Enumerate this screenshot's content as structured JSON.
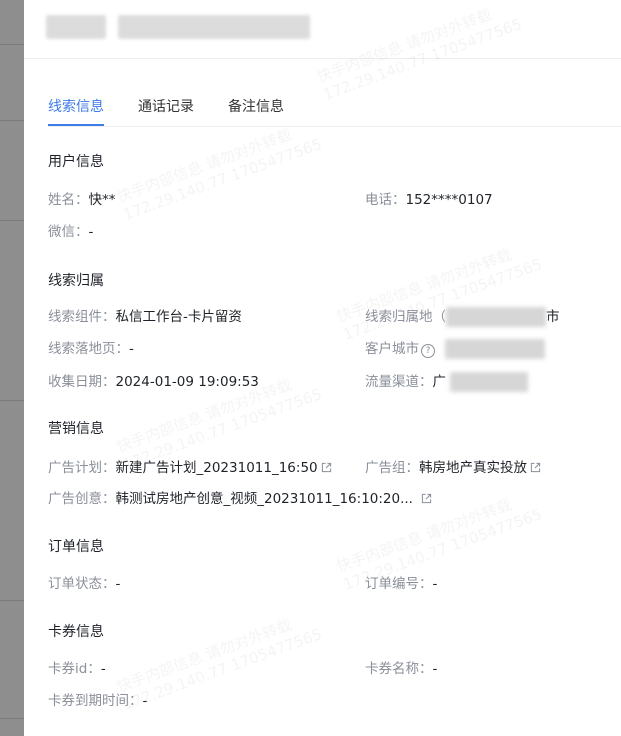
{
  "tabs": [
    {
      "label": "线索信息"
    },
    {
      "label": "通话记录"
    },
    {
      "label": "备注信息"
    }
  ],
  "sections": {
    "user": {
      "title": "用户信息",
      "name_label": "姓名：",
      "name_value": "快**",
      "phone_label": "电话：",
      "phone_value": "152****0107",
      "wechat_label": "微信：",
      "wechat_value": "-"
    },
    "lead": {
      "title": "线索归属",
      "component_label": "线索组件：",
      "component_value": "私信工作台-卡片留资",
      "region_label": "线索归属地（",
      "region_suffix": "市",
      "landing_label": "线索落地页：",
      "landing_value": "-",
      "city_label": "客户城市",
      "date_label": "收集日期：",
      "date_value": "2024-01-09 19:09:53",
      "channel_label": "流量渠道：",
      "channel_prefix": "广"
    },
    "marketing": {
      "title": "营销信息",
      "plan_label": "广告计划：",
      "plan_value": "新建广告计划_20231011_16:50",
      "group_label": "广告组：",
      "group_value": "韩房地产真实投放",
      "creative_label": "广告创意：",
      "creative_value": "韩测试房地产创意_视频_20231011_16:10:20..."
    },
    "order": {
      "title": "订单信息",
      "status_label": "订单状态：",
      "status_value": "-",
      "number_label": "订单编号：",
      "number_value": "-"
    },
    "coupon": {
      "title": "卡券信息",
      "id_label": "卡券id：",
      "id_value": "-",
      "name_label": "卡券名称：",
      "name_value": "-",
      "expire_label": "卡券到期时间：",
      "expire_value": "-"
    }
  },
  "watermark": {
    "line1": "快手内部信息 请勿对外转载",
    "line2": "172.29.140.77 1705477565"
  },
  "colors": {
    "accent": "#3e7ce8",
    "label": "#8a8f99",
    "text": "#1f2329"
  }
}
